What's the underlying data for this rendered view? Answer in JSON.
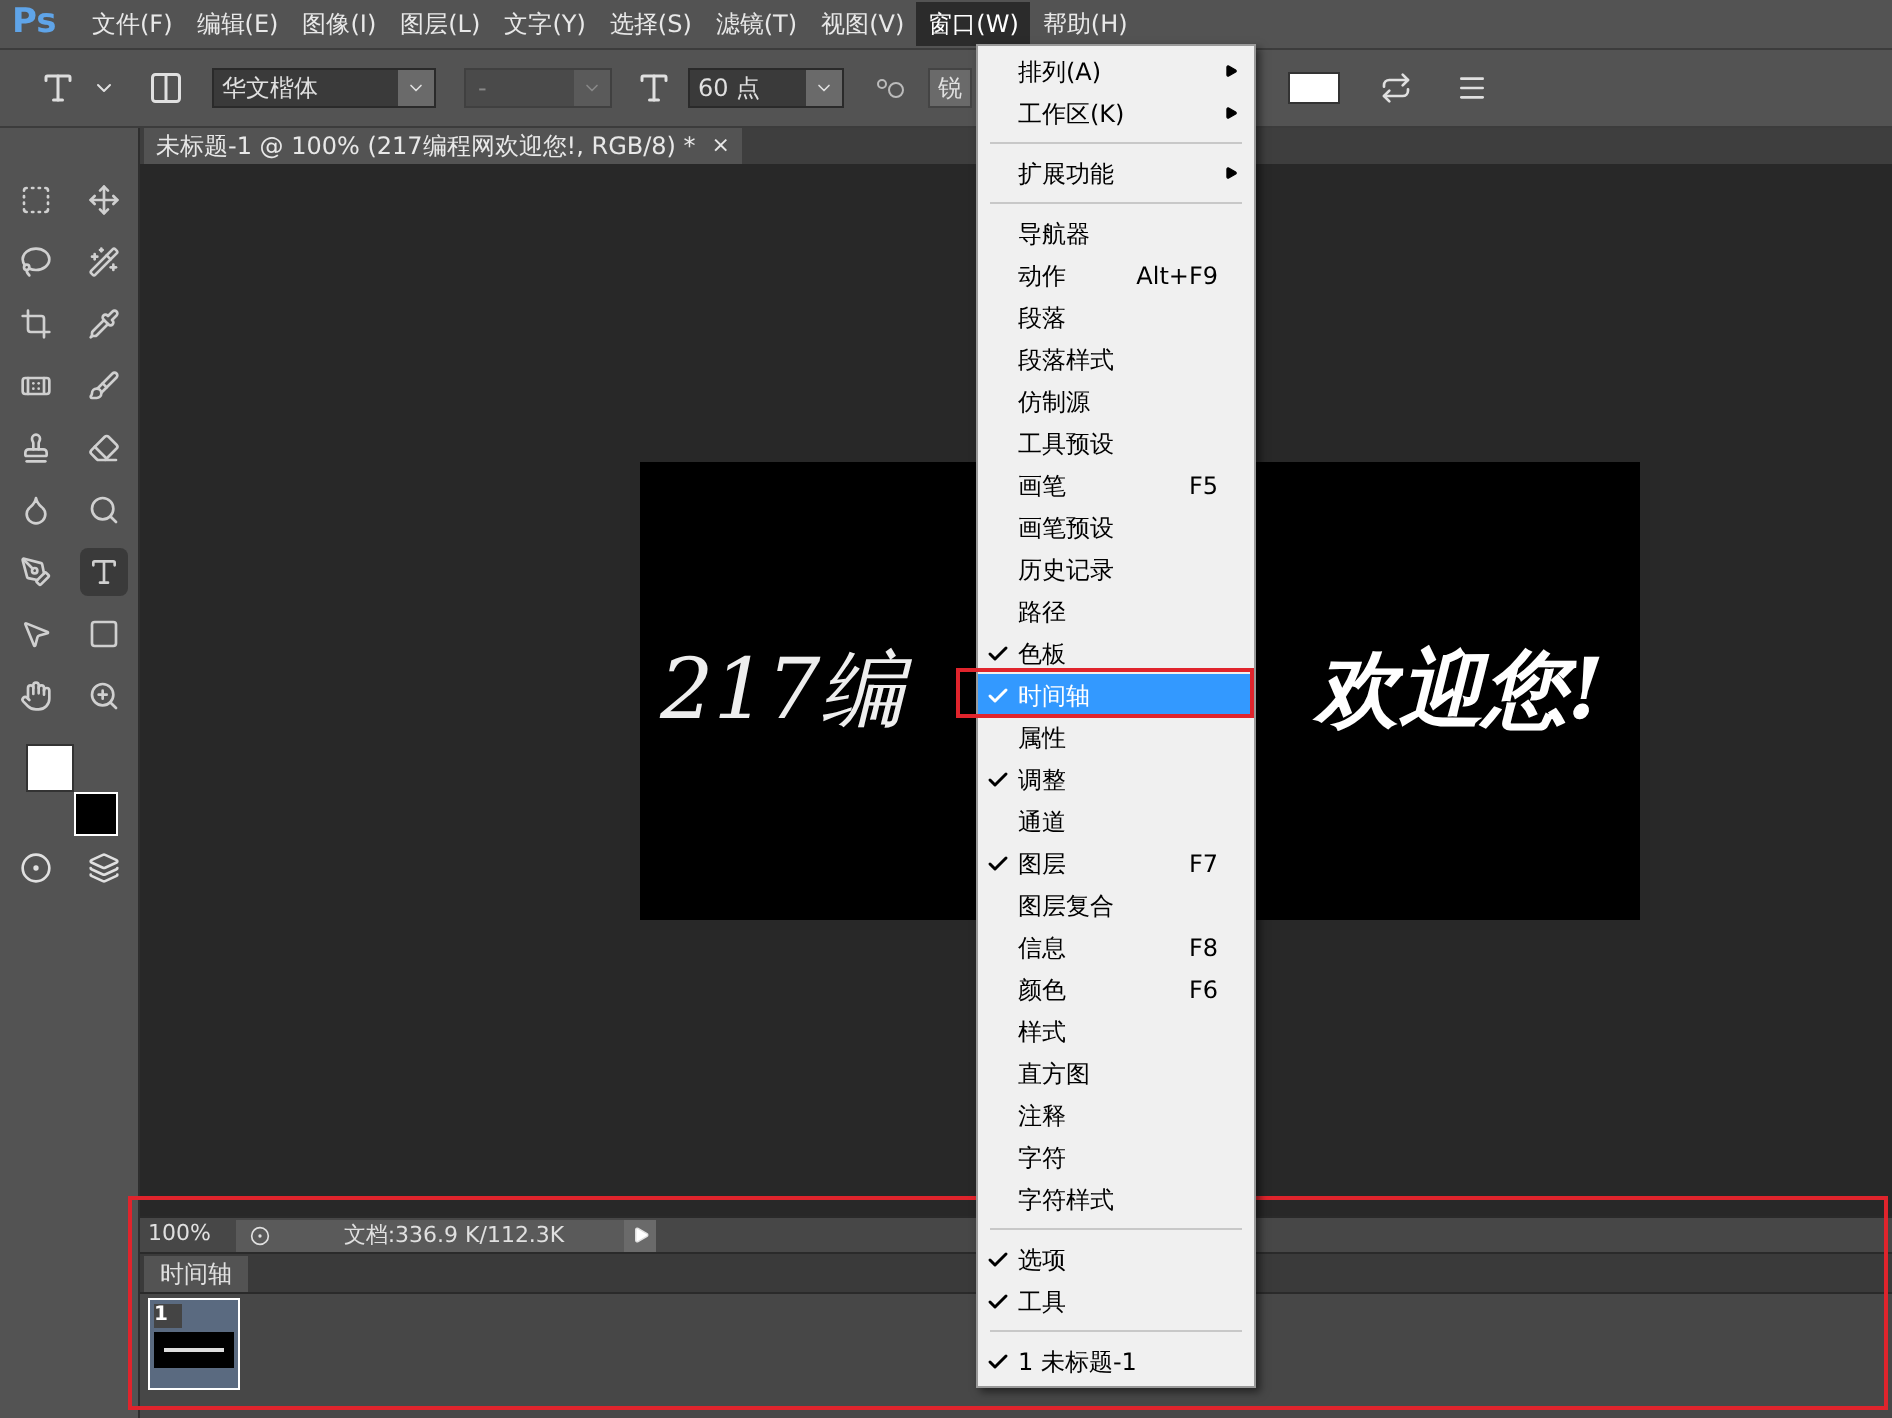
{
  "menubar": {
    "logo": "Ps",
    "menus": [
      {
        "label": "文件(F)",
        "selected": false
      },
      {
        "label": "编辑(E)",
        "selected": false
      },
      {
        "label": "图像(I)",
        "selected": false
      },
      {
        "label": "图层(L)",
        "selected": false
      },
      {
        "label": "文字(Y)",
        "selected": false
      },
      {
        "label": "选择(S)",
        "selected": false
      },
      {
        "label": "滤镜(T)",
        "selected": false
      },
      {
        "label": "视图(V)",
        "selected": false
      },
      {
        "label": "窗口(W)",
        "selected": true
      },
      {
        "label": "帮助(H)",
        "selected": false
      }
    ]
  },
  "options_bar": {
    "font_family": "华文楷体",
    "font_style": "-",
    "font_size": "60 点",
    "antialias": "锐"
  },
  "document_tab": {
    "title": "未标题-1 @ 100% (217编程网欢迎您!, RGB/8) *",
    "close": "×"
  },
  "canvas": {
    "text_left": "217编",
    "text_right": "欢迎您!"
  },
  "window_menu": [
    {
      "kind": "item",
      "label": "排列(A)",
      "submenu": true,
      "checked": false,
      "selected": false
    },
    {
      "kind": "item",
      "label": "工作区(K)",
      "submenu": true,
      "checked": false,
      "selected": false
    },
    {
      "kind": "separator"
    },
    {
      "kind": "item",
      "label": "扩展功能",
      "submenu": true,
      "checked": false,
      "selected": false
    },
    {
      "kind": "separator"
    },
    {
      "kind": "item",
      "label": "导航器",
      "checked": false,
      "selected": false
    },
    {
      "kind": "item",
      "label": "动作",
      "shortcut": "Alt+F9",
      "checked": false,
      "selected": false
    },
    {
      "kind": "item",
      "label": "段落",
      "checked": false,
      "selected": false
    },
    {
      "kind": "item",
      "label": "段落样式",
      "checked": false,
      "selected": false
    },
    {
      "kind": "item",
      "label": "仿制源",
      "checked": false,
      "selected": false
    },
    {
      "kind": "item",
      "label": "工具预设",
      "checked": false,
      "selected": false
    },
    {
      "kind": "item",
      "label": "画笔",
      "shortcut": "F5",
      "checked": false,
      "selected": false
    },
    {
      "kind": "item",
      "label": "画笔预设",
      "checked": false,
      "selected": false
    },
    {
      "kind": "item",
      "label": "历史记录",
      "checked": false,
      "selected": false
    },
    {
      "kind": "item",
      "label": "路径",
      "checked": false,
      "selected": false
    },
    {
      "kind": "item",
      "label": "色板",
      "checked": true,
      "selected": false
    },
    {
      "kind": "item",
      "label": "时间轴",
      "checked": true,
      "selected": true
    },
    {
      "kind": "item",
      "label": "属性",
      "checked": false,
      "selected": false
    },
    {
      "kind": "item",
      "label": "调整",
      "checked": true,
      "selected": false
    },
    {
      "kind": "item",
      "label": "通道",
      "checked": false,
      "selected": false
    },
    {
      "kind": "item",
      "label": "图层",
      "shortcut": "F7",
      "checked": true,
      "selected": false
    },
    {
      "kind": "item",
      "label": "图层复合",
      "checked": false,
      "selected": false
    },
    {
      "kind": "item",
      "label": "信息",
      "shortcut": "F8",
      "checked": false,
      "selected": false
    },
    {
      "kind": "item",
      "label": "颜色",
      "shortcut": "F6",
      "checked": false,
      "selected": false
    },
    {
      "kind": "item",
      "label": "样式",
      "checked": false,
      "selected": false
    },
    {
      "kind": "item",
      "label": "直方图",
      "checked": false,
      "selected": false
    },
    {
      "kind": "item",
      "label": "注释",
      "checked": false,
      "selected": false
    },
    {
      "kind": "item",
      "label": "字符",
      "checked": false,
      "selected": false
    },
    {
      "kind": "item",
      "label": "字符样式",
      "checked": false,
      "selected": false
    },
    {
      "kind": "separator"
    },
    {
      "kind": "item",
      "label": "选项",
      "checked": true,
      "selected": false
    },
    {
      "kind": "item",
      "label": "工具",
      "checked": true,
      "selected": false
    },
    {
      "kind": "separator"
    },
    {
      "kind": "item",
      "label": "1 未标题-1",
      "checked": true,
      "selected": false
    }
  ],
  "status_bar": {
    "zoom": "100%",
    "doc_info": "文档:336.9 K/112.3K"
  },
  "timeline": {
    "tab": "时间轴",
    "frames": [
      {
        "number": "1",
        "selected": true
      }
    ]
  }
}
